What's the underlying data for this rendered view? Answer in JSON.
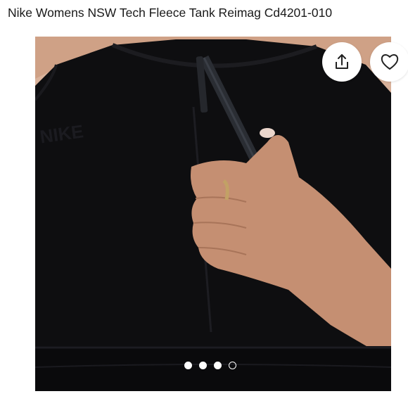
{
  "listing": {
    "title": "Nike Womens NSW Tech Fleece Tank Reimag Cd4201-010"
  },
  "gallery": {
    "total_images": 4,
    "active_index": 3,
    "logo_text": "NIKE"
  },
  "actions": {
    "share_icon": "share-icon",
    "like_icon": "heart-icon"
  },
  "colors": {
    "garment": "#0d0d0f",
    "skin": "#c9967a",
    "background": "#ffffff"
  }
}
